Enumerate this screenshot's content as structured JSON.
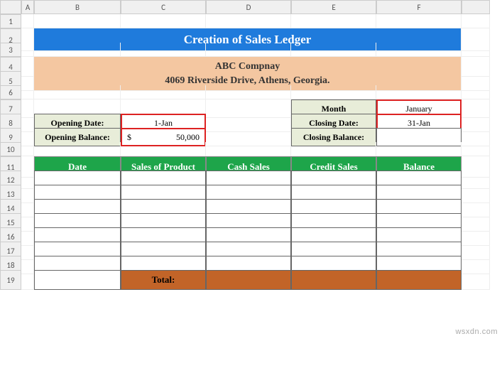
{
  "columns": [
    "A",
    "B",
    "C",
    "D",
    "E",
    "F"
  ],
  "rows": [
    "1",
    "2",
    "3",
    "4",
    "5",
    "6",
    "7",
    "8",
    "9",
    "10",
    "11",
    "12",
    "13",
    "14",
    "15",
    "16",
    "17",
    "18",
    "19"
  ],
  "title": "Creation of Sales Ledger",
  "company": {
    "name": "ABC Compnay",
    "address": "4069 Riverside Drive, Athens, Georgia."
  },
  "labels": {
    "month": "Month",
    "opening_date": "Opening Date:",
    "closing_date": "Closing Date:",
    "opening_balance": "Opening Balance:",
    "closing_balance": "Closing Balance:",
    "total": "Total:"
  },
  "values": {
    "month": "January",
    "opening_date": "1-Jan",
    "closing_date": "31-Jan",
    "opening_balance_currency": "$",
    "opening_balance": "50,000",
    "closing_balance": ""
  },
  "table_headers": [
    "Date",
    "Sales of Product",
    "Cash Sales",
    "Credit Sales",
    "Balance"
  ],
  "watermark": "wsxdn.com"
}
